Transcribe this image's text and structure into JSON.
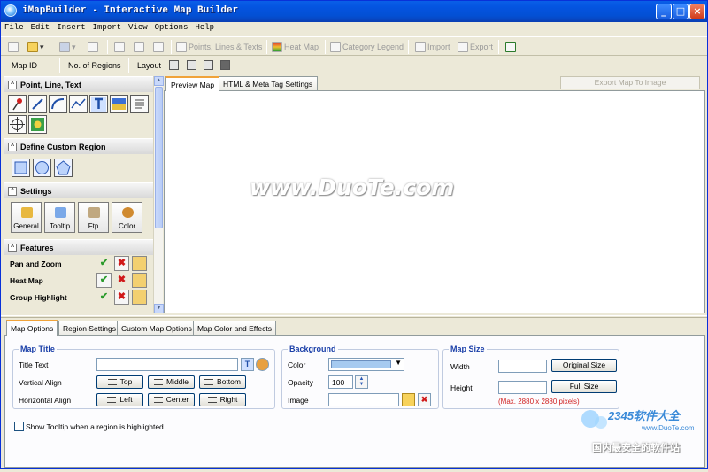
{
  "window": {
    "title": "iMapBuilder - Interactive Map Builder"
  },
  "menu": [
    "File",
    "Edit",
    "Insert",
    "Import",
    "View",
    "Options",
    "Help"
  ],
  "toolbar": {
    "points_lines_texts": "Points, Lines & Texts",
    "heat_map": "Heat Map",
    "category_legend": "Category Legend",
    "import": "Import",
    "export": "Export"
  },
  "mapbar": {
    "map_id": "Map ID",
    "num_regions": "No. of Regions",
    "layout": "Layout"
  },
  "left": {
    "section_plt": "Point, Line, Text",
    "section_region": "Define Custom Region",
    "section_settings": "Settings",
    "settings_buttons": [
      "General",
      "Tooltip",
      "Ftp",
      "Color"
    ],
    "section_features": "Features",
    "features": [
      "Pan and Zoom",
      "Heat Map",
      "Group Highlight"
    ]
  },
  "preview": {
    "tabs": [
      "Preview Map",
      "HTML & Meta Tag Settings"
    ],
    "export_button": "Export Map To Image",
    "watermark": "www.DuoTe.com"
  },
  "bottom": {
    "tabs": [
      "Map Options",
      "Region Settings",
      "Custom Map Options",
      "Map Color and Effects"
    ],
    "map_title": {
      "heading": "Map Title",
      "title_text_label": "Title Text",
      "title_text_value": "",
      "vertical_align_label": "Vertical Align",
      "vertical_options": [
        "Top",
        "Middle",
        "Bottom"
      ],
      "horizontal_align_label": "Horizontal Align",
      "horizontal_options": [
        "Left",
        "Center",
        "Right"
      ]
    },
    "background": {
      "heading": "Background",
      "color_label": "Color",
      "color_value": "#A6CAF0",
      "opacity_label": "Opacity",
      "opacity_value": "100",
      "image_label": "Image",
      "image_value": ""
    },
    "map_size": {
      "heading": "Map Size",
      "width_label": "Width",
      "height_label": "Height",
      "original_size_button": "Original Size",
      "full_size_button": "Full Size",
      "max_note": "(Max. 2880 x 2880 pixels)"
    },
    "tooltip_checkbox": "Show Tooltip when a region is highlighted"
  },
  "corner_logo": {
    "brand": "2345软件大全",
    "site": "www.DuoTe.com",
    "slogan": "国内最安全的软件站"
  },
  "colors": {
    "titlebar": "#0454E0",
    "accent_tab": "#F0A33A",
    "group_title": "#1A3FA8",
    "max_note": "#D02020"
  }
}
